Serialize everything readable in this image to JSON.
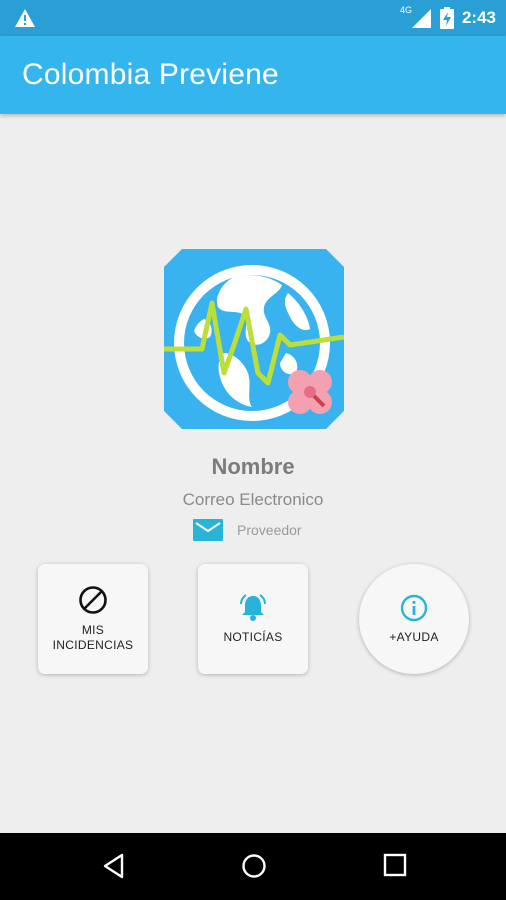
{
  "status_bar": {
    "network": "4G",
    "time": "2:43",
    "icons": [
      "warning-icon",
      "signal-icon",
      "battery-charging-icon"
    ]
  },
  "app_bar": {
    "title": "Colombia Previene"
  },
  "profile": {
    "name": "Nombre",
    "email": "Correo Electronico",
    "provider": "Proveedor"
  },
  "actions": [
    {
      "icon": "block-icon",
      "label": "MIS INCIDENCIAS"
    },
    {
      "icon": "bell-icon",
      "label": "NOTICÍAS"
    },
    {
      "icon": "info-icon",
      "label": "+AYUDA"
    }
  ],
  "colors": {
    "status_bar": "#2a9fd6",
    "app_bar": "#35b5ee",
    "accent": "#28b4d9",
    "logo_bg": "#38b3ef",
    "wave": "#bcde3a",
    "flower": "#f3a0b0"
  },
  "nav_bar": {
    "buttons": [
      "back-icon",
      "home-icon",
      "recents-icon"
    ]
  }
}
